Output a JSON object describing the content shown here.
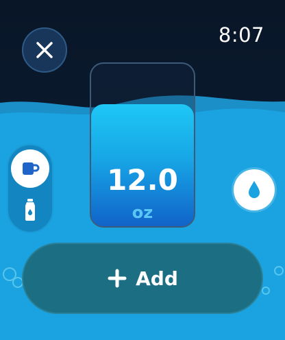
{
  "status": {
    "time": "8:07"
  },
  "glass": {
    "amount": "12.0",
    "unit": "oz"
  },
  "actions": {
    "add_label": "Add"
  },
  "icons": {
    "close": "close-icon",
    "mug": "mug-icon",
    "bottle": "water-bottle-icon",
    "drop": "water-drop-icon",
    "plus": "plus-icon"
  },
  "colors": {
    "background_dark": "#0b1a2e",
    "water": "#1aa3e0",
    "water_deep": "#1163c9",
    "button": "#1c6e83",
    "accent": "#1f64c9"
  }
}
